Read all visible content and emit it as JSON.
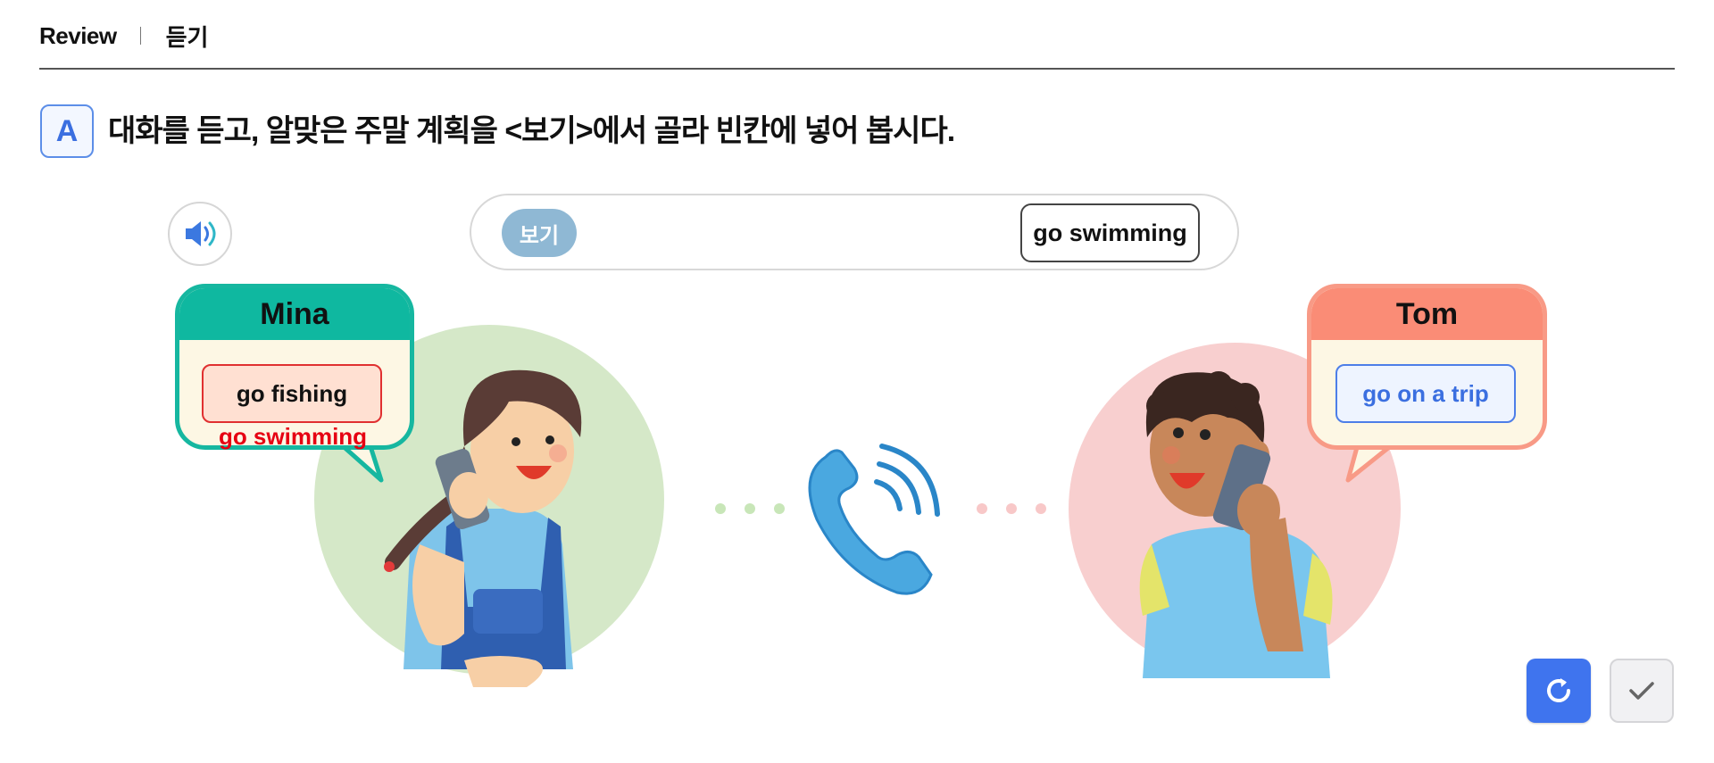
{
  "header": {
    "section": "Review",
    "subsection": "듣기"
  },
  "instruction": {
    "badge": "A",
    "text": "대화를 듣고, 알맞은 주말 계획을 <보기>에서 골라 빈칸에 넣어 봅시다."
  },
  "audio": {
    "icon": "speaker-icon"
  },
  "word_bank": {
    "label": "보기",
    "options": [
      "go swimming"
    ]
  },
  "characters": {
    "mina": {
      "name": "Mina",
      "answer": "go fishing",
      "correct_answer": "go swimming",
      "accent": "#0fb8a0"
    },
    "tom": {
      "name": "Tom",
      "answer": "go on a trip",
      "accent": "#fa8c76"
    }
  },
  "controls": {
    "reset_icon": "refresh-icon",
    "check_icon": "check-icon"
  },
  "colors": {
    "accent_blue": "#3f74ee",
    "wrong_red": "#e60012",
    "mina_circle": "#d5e8c8",
    "tom_circle": "#f8cfcf"
  }
}
